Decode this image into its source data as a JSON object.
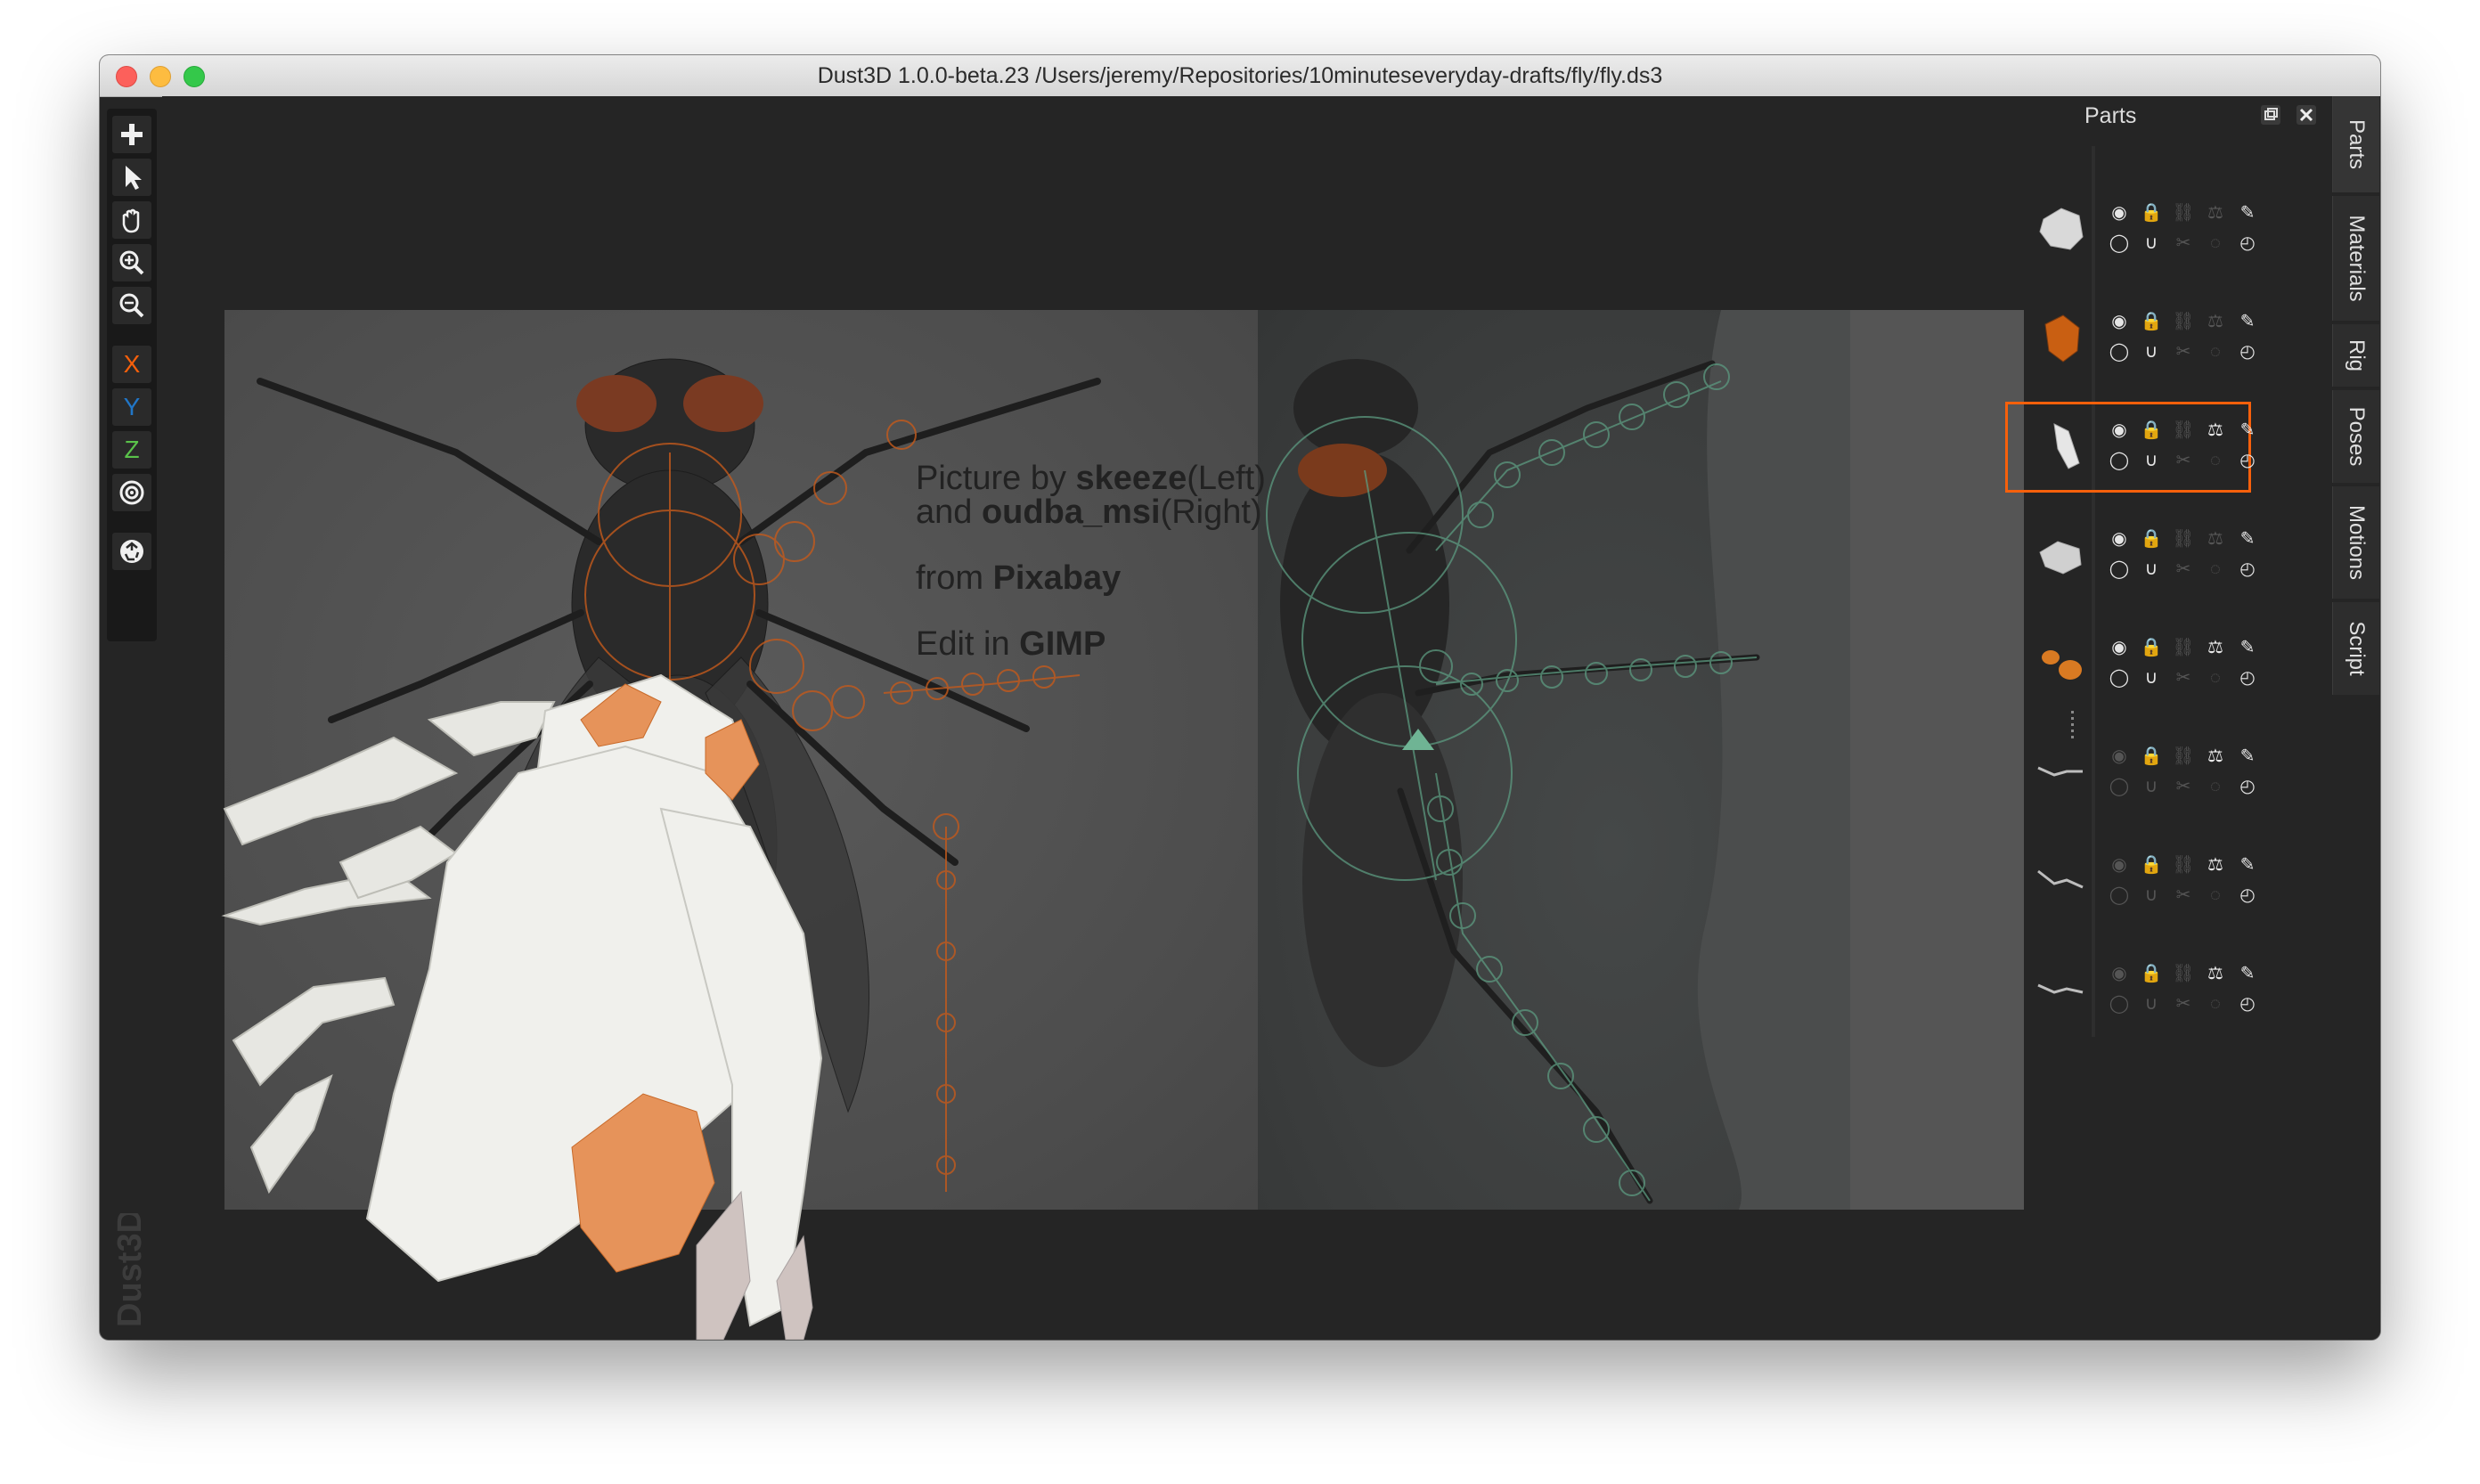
{
  "window": {
    "title": "Dust3D 1.0.0-beta.23 /Users/jeremy/Repositories/10minuteseveryday-drafts/fly/fly.ds3"
  },
  "toolbar": {
    "tools": [
      {
        "name": "add-icon",
        "label": "+"
      },
      {
        "name": "select-icon",
        "label": ""
      },
      {
        "name": "hand-icon",
        "label": ""
      },
      {
        "name": "zoom-in-icon",
        "label": ""
      },
      {
        "name": "zoom-out-icon",
        "label": ""
      }
    ],
    "axes": [
      {
        "label": "X",
        "color": "#f7600b"
      },
      {
        "label": "Y",
        "color": "#2176c7"
      },
      {
        "label": "Z",
        "color": "#5ac24a"
      }
    ],
    "radial_icon": "radial-icon",
    "regenerate_icon": "recycle-icon",
    "brand": "Dust3D"
  },
  "reference": {
    "credit_line1_prefix": "Picture by ",
    "credit_line1_name": "skeeze",
    "credit_line1_suffix": "(Left)",
    "credit_line2_prefix": "and ",
    "credit_line2_name": "oudba_msi",
    "credit_line2_suffix": "(Right)",
    "credit_line3_prefix": "from ",
    "credit_line3_name": "Pixabay",
    "credit_line4_prefix": "Edit in ",
    "credit_line4_name": "GIMP"
  },
  "parts_panel": {
    "title": "Parts",
    "float_icon": "float-icon",
    "close_icon": "close-icon",
    "accent": "#f7600b",
    "parts": [
      {
        "thumb": "body-part",
        "color": "#d9d9d9",
        "selected": false
      },
      {
        "thumb": "head-part",
        "color": "#c95f12",
        "selected": false
      },
      {
        "thumb": "wing-part",
        "color": "#e6e6e6",
        "selected": true
      },
      {
        "thumb": "thorax-part",
        "color": "#d0d0d0",
        "selected": false
      },
      {
        "thumb": "eye-part",
        "color": "#d97a22",
        "selected": false
      },
      {
        "thumb": "leg-part-1",
        "color": "#bdbdbd",
        "selected": false
      },
      {
        "thumb": "leg-part-2",
        "color": "#bdbdbd",
        "selected": false
      },
      {
        "thumb": "leg-part-3",
        "color": "#bdbdbd",
        "selected": false
      }
    ]
  },
  "side_tabs": [
    {
      "label": "Parts"
    },
    {
      "label": "Materials"
    },
    {
      "label": "Rig"
    },
    {
      "label": "Poses"
    },
    {
      "label": "Motions"
    },
    {
      "label": "Script"
    }
  ]
}
